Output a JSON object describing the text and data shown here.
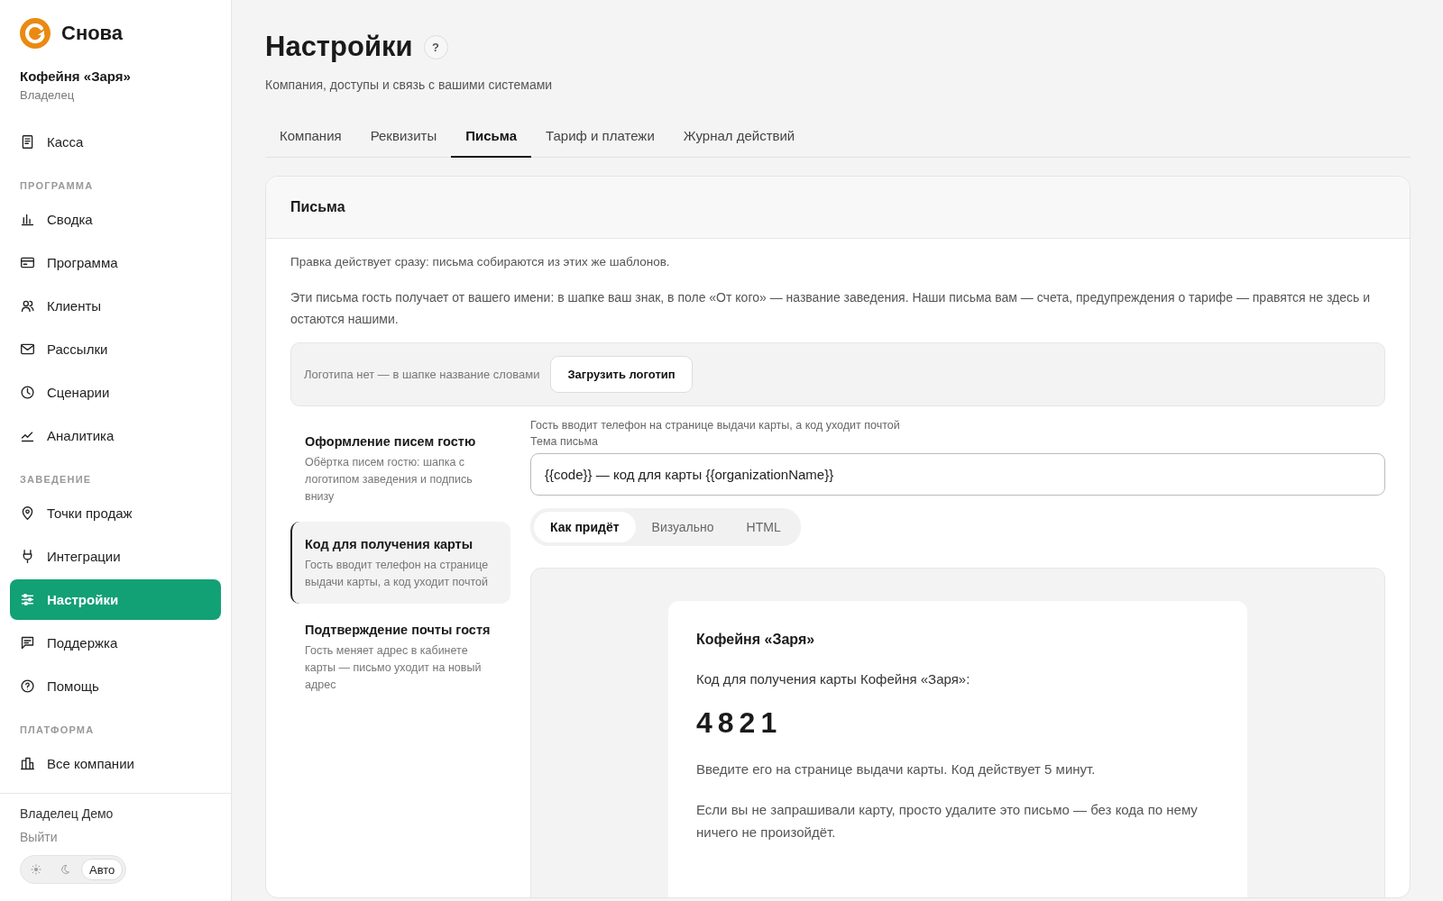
{
  "brand": {
    "name": "Снова"
  },
  "org": {
    "name": "Кофейня «Заря»",
    "role": "Владелец"
  },
  "sidebar": {
    "items": [
      {
        "kind": "item",
        "label": "Касса",
        "selected": false
      },
      {
        "kind": "section",
        "label": "ПРОГРАММА"
      },
      {
        "kind": "item",
        "label": "Сводка",
        "selected": false
      },
      {
        "kind": "item",
        "label": "Программа",
        "selected": false
      },
      {
        "kind": "item",
        "label": "Клиенты",
        "selected": false
      },
      {
        "kind": "item",
        "label": "Рассылки",
        "selected": false
      },
      {
        "kind": "item",
        "label": "Сценарии",
        "selected": false
      },
      {
        "kind": "item",
        "label": "Аналитика",
        "selected": false
      },
      {
        "kind": "section",
        "label": "ЗАВЕДЕНИЕ"
      },
      {
        "kind": "item",
        "label": "Точки продаж",
        "selected": false
      },
      {
        "kind": "item",
        "label": "Интеграции",
        "selected": false
      },
      {
        "kind": "item",
        "label": "Настройки",
        "selected": true
      },
      {
        "kind": "item",
        "label": "Поддержка",
        "selected": false
      },
      {
        "kind": "item",
        "label": "Помощь",
        "selected": false
      },
      {
        "kind": "section",
        "label": "ПЛАТФОРМА"
      },
      {
        "kind": "item",
        "label": "Все компании",
        "selected": false
      }
    ]
  },
  "user": {
    "name": "Владелец Демо",
    "logout": "Выйти"
  },
  "theme_switch": [
    {
      "kind": "sun",
      "selected": false
    },
    {
      "kind": "moon",
      "selected": false
    },
    {
      "kind": "text",
      "label": "Авто",
      "selected": true
    }
  ],
  "page": {
    "title": "Настройки",
    "help": "?",
    "subtitle": "Компания, доступы и связь с вашими системами"
  },
  "tabs": [
    {
      "label": "Компания",
      "selected": false
    },
    {
      "label": "Реквизиты",
      "selected": false
    },
    {
      "label": "Письма",
      "selected": true
    },
    {
      "label": "Тариф и платежи",
      "selected": false
    },
    {
      "label": "Журнал действий",
      "selected": false
    }
  ],
  "panel": {
    "title": "Письма",
    "note": "Правка действует сразу: письма собираются из этих же шаблонов.",
    "description": "Эти письма гость получает от вашего имени: в шапке ваш знак, в поле «От кого» — название заведения. Наши письма вам — счета, предупреждения о тарифе — правятся не здесь и остаются нашими.",
    "logo_bar": {
      "text": "Логотипа нет — в шапке название словами",
      "button": "Загрузить логотип"
    },
    "templates": [
      {
        "title": "Оформление писем гостю",
        "description": "Обёртка писем гостю: шапка с логотипом заведения и подпись внизу",
        "selected": false
      },
      {
        "title": "Код для получения карты",
        "description": "Гость вводит телефон на странице выдачи карты, а код уходит почтой",
        "selected": true
      },
      {
        "title": "Подтверждение почты гостя",
        "description": "Гость меняет адрес в кабинете карты — письмо уходит на новый адрес",
        "selected": false
      }
    ],
    "editor": {
      "hint": "Гость вводит телефон на странице выдачи карты, а код уходит почтой",
      "subject_label": "Тема письма",
      "subject": "{{code}} — код для карты {{organizationName}}",
      "modes": [
        {
          "label": "Как придёт",
          "selected": true
        },
        {
          "label": "Визуально",
          "selected": false
        },
        {
          "label": "HTML",
          "selected": false
        }
      ],
      "preview": {
        "header": "Кофейня «Заря»",
        "lead": "Код для получения карты Кофейня «Заря»:",
        "code": "4821",
        "paragraphs": [
          "Введите его на странице выдачи карты. Код действует 5 минут.",
          "Если вы не запрашивали карту, просто удалите это письмо — без кода по нему ничего не произойдёт."
        ]
      }
    }
  }
}
